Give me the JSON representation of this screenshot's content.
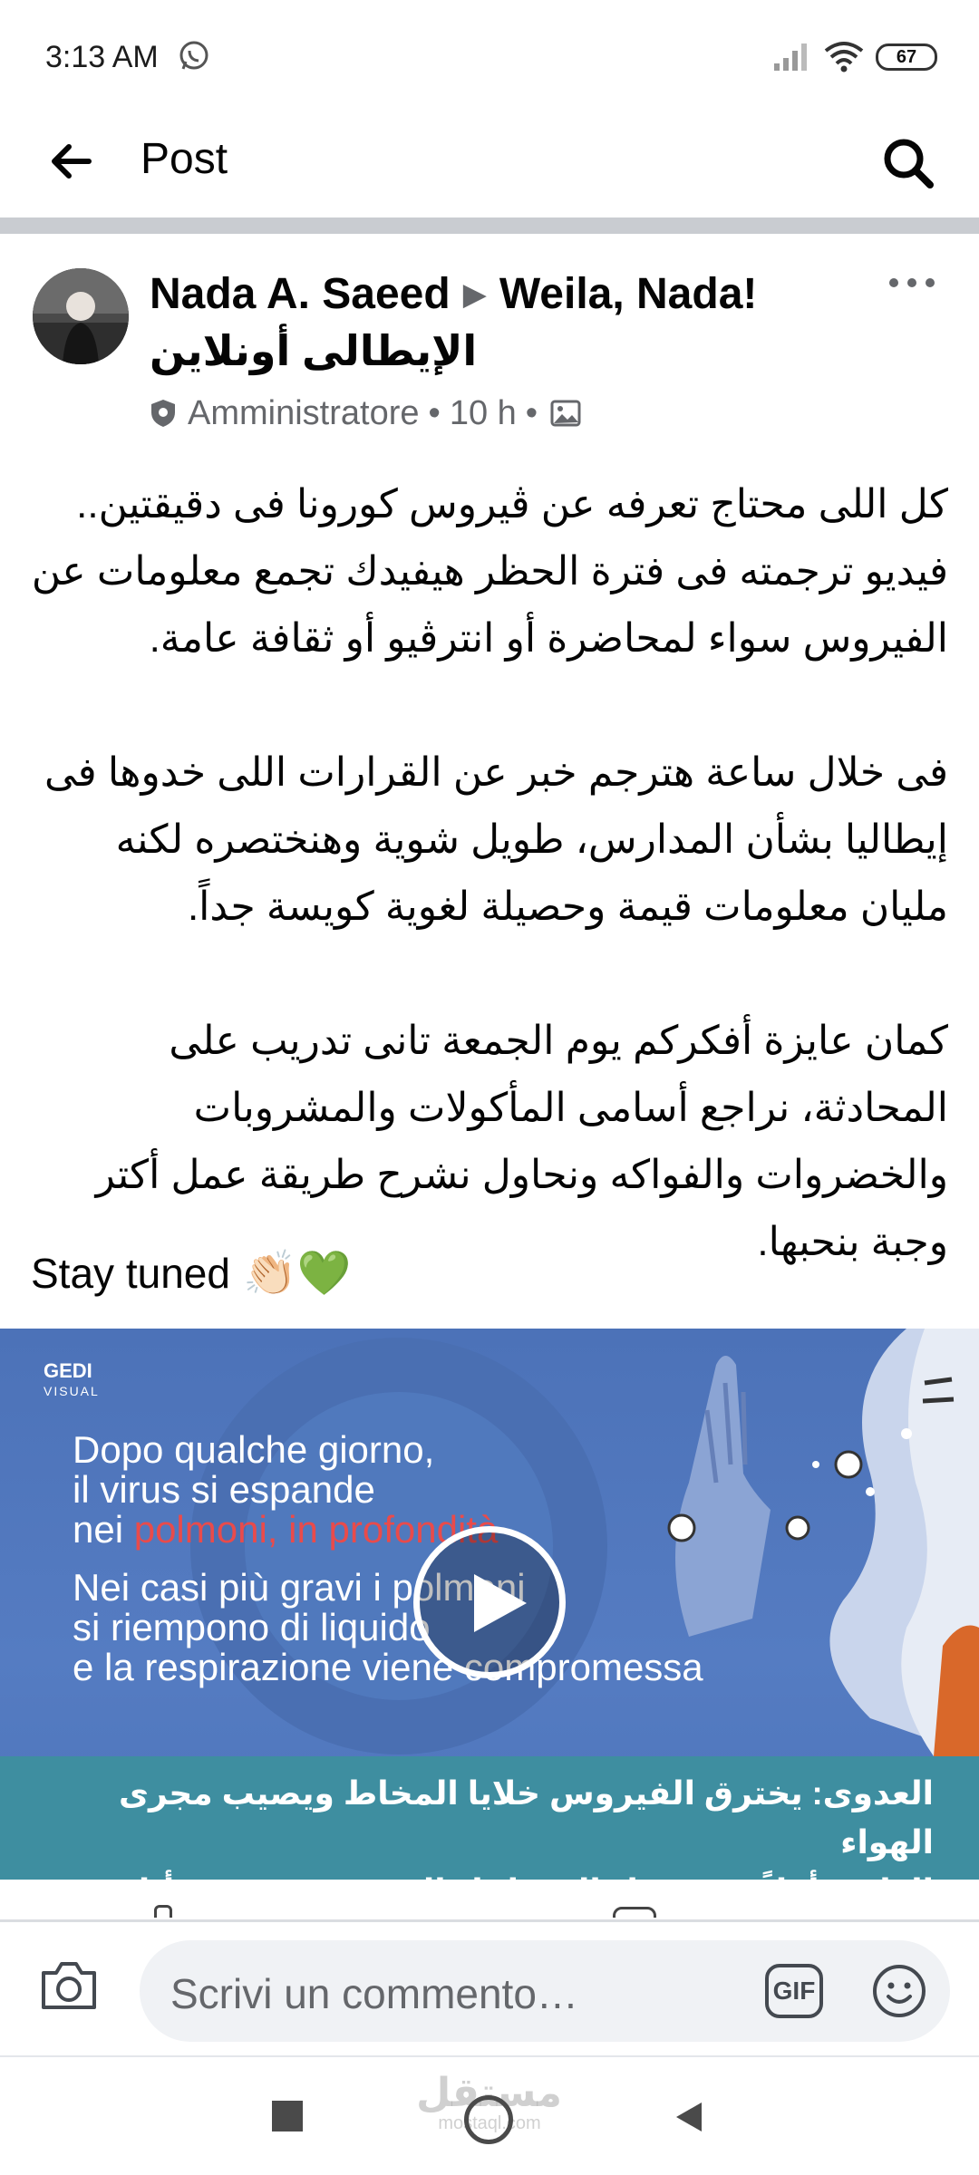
{
  "status_bar": {
    "time": "3:13 AM",
    "battery": "67",
    "icons": [
      "whatsapp-icon",
      "signal-icon",
      "wifi-icon",
      "battery-icon"
    ]
  },
  "header": {
    "title": "Post",
    "icons": [
      "back-arrow-icon",
      "search-icon"
    ]
  },
  "post": {
    "author": "Nada A. Saeed",
    "group": "Weila, Nada!",
    "group_arabic": "الإيطالى أونلاين",
    "role": "Amministratore",
    "time": "10 h",
    "paragraphs": [
      "كل اللى محتاج تعرفه عن ڤيروس كورونا فى دقيقتين.. فيديو ترجمته فى فترة الحظر هيفيدك تجمع معلومات عن الفيروس سواء لمحاضرة أو انترڤيو أو ثقافة عامة.",
      "فى خلال ساعة هترجم خبر عن القرارات اللى خدوها فى إيطاليا بشأن المدارس، طويل شوية وهنختصره لكنه مليان معلومات قيمة وحصيلة لغوية كويسة جداً.",
      "كمان عايزة أفكركم يوم الجمعة تانى تدريب على المحادثة، نراجع أسامى المأكولات والمشروبات والخضروات والفواكه ونحاول نشرح طريقة عمل أكتر وجبة بنحبها."
    ],
    "stay_tuned": "Stay tuned",
    "stay_tuned_emoji": "👏🏻💚"
  },
  "video": {
    "logo": "GEDI",
    "logo_sub": "VISUAL",
    "line1": "Dopo qualche giorno,",
    "line2": "il virus si espande",
    "line3_prefix": "nei ",
    "line3_highlight": "polmoni, in profondità",
    "line4": "Nei casi più gravi i polmoni",
    "line5": "si riempono di liquido",
    "line6": "e la respirazione viene compromessa",
    "caption_line1": "العدوى: يخترق الفيروس خلايا المخاط ويصيب مجرى الهواء",
    "caption_line2": "العلوى أولاً ثم يتوغل إلى داخل الرئتين بعد بضعة أيام"
  },
  "comment_bar": {
    "placeholder": "Scrivi un commento…",
    "gif_label": "GIF"
  },
  "watermark": {
    "arabic": "مستقل",
    "latin": "mostaql.com"
  },
  "colors": {
    "text_primary": "#050505",
    "text_secondary": "#65676b",
    "separator": "#c9ccd1",
    "video_blue": "#557cc2",
    "caption_teal": "#3e8ea0",
    "highlight_red": "#e94b4b"
  }
}
